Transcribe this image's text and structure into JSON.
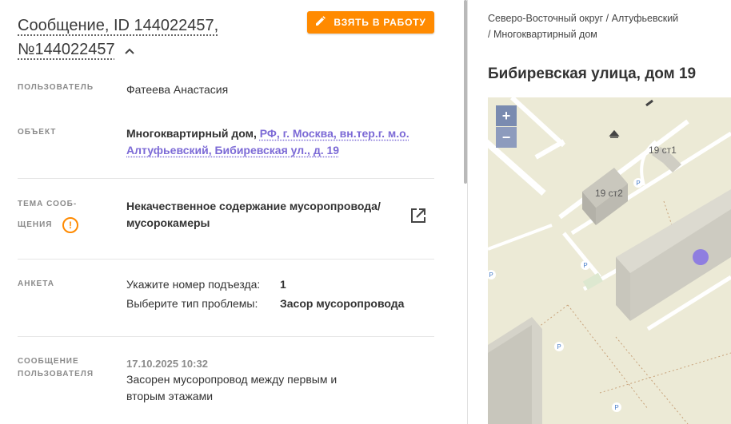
{
  "header": {
    "title_line1": "Сообщение, ID 144022457,",
    "title_line2": "№144022457",
    "take_button": "ВЗЯТЬ В РАБОТУ"
  },
  "fields": {
    "user_label": "ПОЛЬЗОВАТЕЛЬ",
    "user_value": "Фатеева Анастасия",
    "object_label": "ОБЪЕКТ",
    "object_type": "Многоквартирный дом,",
    "object_address_1": "РФ, г. Москва, вн.тер.г. м.о.",
    "object_address_2": "Алтуфьевский, Бибиревская ул., д. 19",
    "topic_label_1": "ТЕМА СООБ-",
    "topic_label_2": "ЩЕНИЯ",
    "topic_value_1": "Некачественное содержание мусоропровода/",
    "topic_value_2": "мусорокамеры",
    "survey_label": "АНКЕТА",
    "survey_q1": "Укажите номер подъезда:",
    "survey_a1": "1",
    "survey_q2": "Выберите тип проблемы:",
    "survey_a2": "Засор мусоропровода",
    "message_label_1": "СООБЩЕНИЕ",
    "message_label_2": "ПОЛЬЗОВАТЕЛЯ",
    "message_date": "17.10.2025 10:32",
    "message_text_1": "Засорен мусоропровод между первым и",
    "message_text_2": "вторым этажами"
  },
  "location": {
    "breadcrumb_1": "Северо-Восточный округ / Алтуфьевский",
    "breadcrumb_2": "/ Многоквартирный дом",
    "address": "Бибиревская улица, дом 19"
  },
  "map": {
    "zoom_in": "+",
    "zoom_out": "−",
    "building_1": "19 ст1",
    "building_2": "19 ст2",
    "parking": "P",
    "marker_color": "#8f7ee0"
  },
  "colors": {
    "accent": "#ff8a00",
    "link": "#7c6ad6"
  }
}
